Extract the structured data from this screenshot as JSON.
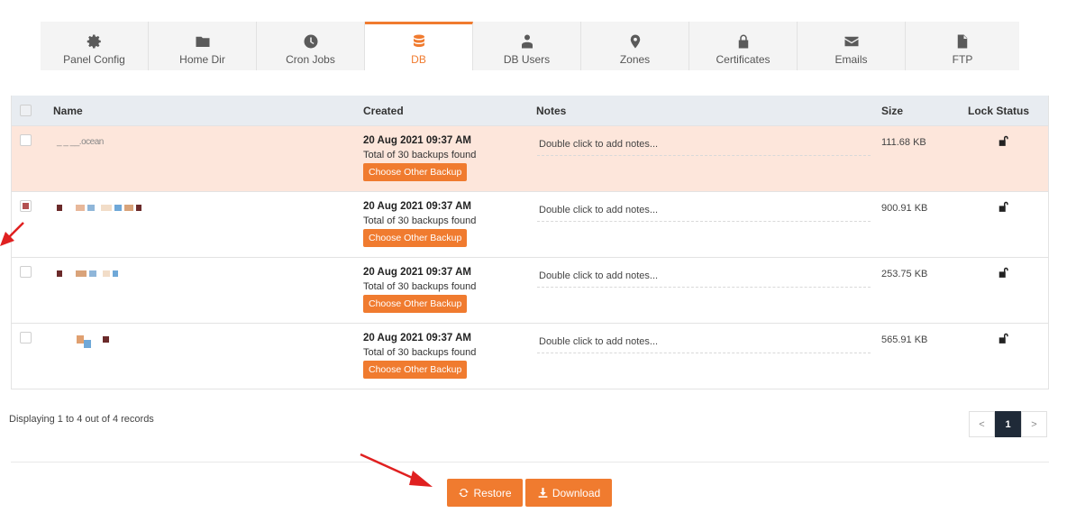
{
  "tabs": [
    {
      "label": "Panel Config",
      "icon": "gear-icon",
      "active": false
    },
    {
      "label": "Home Dir",
      "icon": "folder-icon",
      "active": false
    },
    {
      "label": "Cron Jobs",
      "icon": "clock-icon",
      "active": false
    },
    {
      "label": "DB",
      "icon": "database-icon",
      "active": true
    },
    {
      "label": "DB Users",
      "icon": "users-icon",
      "active": false
    },
    {
      "label": "Zones",
      "icon": "map-marker-icon",
      "active": false
    },
    {
      "label": "Certificates",
      "icon": "lock-icon",
      "active": false
    },
    {
      "label": "Emails",
      "icon": "envelope-icon",
      "active": false
    },
    {
      "label": "FTP",
      "icon": "file-icon",
      "active": false
    }
  ],
  "table": {
    "headers": {
      "name": "Name",
      "created": "Created",
      "notes": "Notes",
      "size": "Size",
      "lock": "Lock Status"
    },
    "rows": [
      {
        "name": "_ _ __.ocean",
        "created": "20 Aug 2021 09:37 AM",
        "backups": "Total of 30 backups found",
        "backup_button": "Choose Other Backup",
        "notes": "Double click to add notes...",
        "size": "111.68 KB",
        "checked": false,
        "highlight": true
      },
      {
        "name": "",
        "created": "20 Aug 2021 09:37 AM",
        "backups": "Total of 30 backups found",
        "backup_button": "Choose Other Backup",
        "notes": "Double click to add notes...",
        "size": "900.91 KB",
        "checked": true,
        "highlight": false
      },
      {
        "name": "",
        "created": "20 Aug 2021 09:37 AM",
        "backups": "Total of 30 backups found",
        "backup_button": "Choose Other Backup",
        "notes": "Double click to add notes...",
        "size": "253.75 KB",
        "checked": false,
        "highlight": false
      },
      {
        "name": "",
        "created": "20 Aug 2021 09:37 AM",
        "backups": "Total of 30 backups found",
        "backup_button": "Choose Other Backup",
        "notes": "Double click to add notes...",
        "size": "565.91 KB",
        "checked": false,
        "highlight": false
      }
    ]
  },
  "footer": {
    "records_text": "Displaying 1 to 4 out of 4 records"
  },
  "pagination": {
    "prev": "<",
    "current": "1",
    "next": ">"
  },
  "actions": {
    "restore_label": "Restore",
    "download_label": "Download"
  },
  "colors": {
    "accent": "#f07b2f",
    "highlight_row": "#fde6db",
    "header_bg": "#e8ecf1",
    "arrow": "#e02020"
  }
}
